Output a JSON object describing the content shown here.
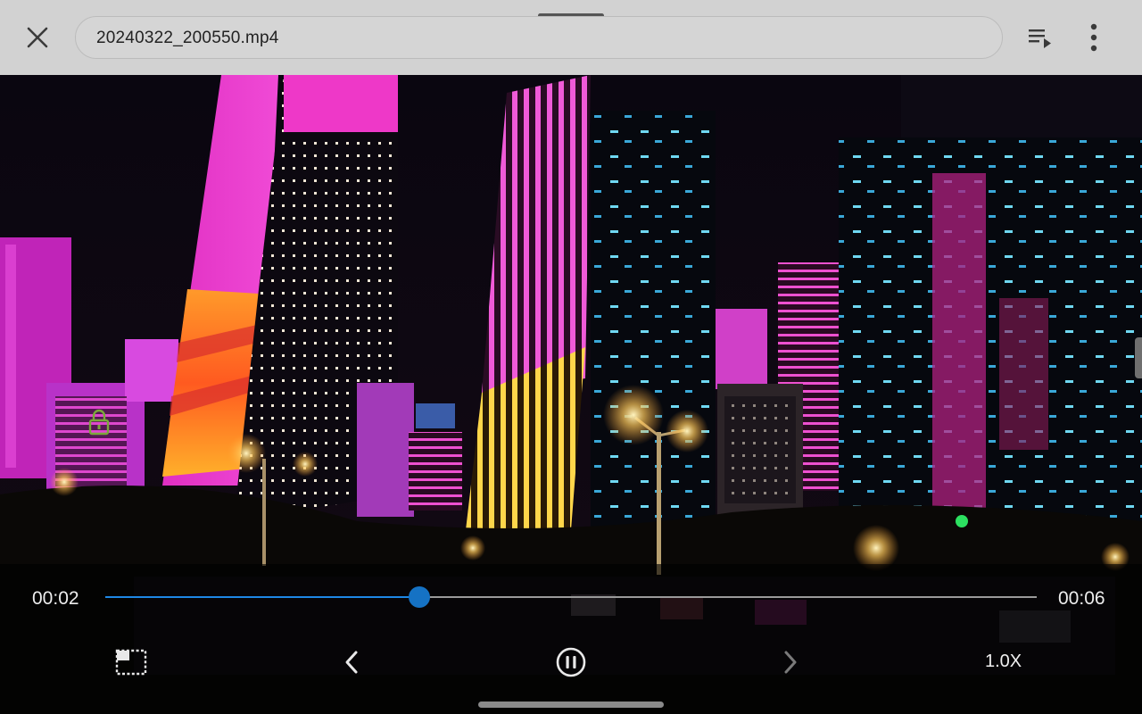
{
  "app": {
    "file_name": "20240322_200550.mp4"
  },
  "icons": {
    "close": "close-icon",
    "playlist": "playlist-play-icon",
    "more": "more-vert-icon",
    "lock": "lock-icon",
    "aspect": "aspect-ratio-icon",
    "previous": "chevron-left-icon",
    "pause": "pause-circle-icon",
    "next": "chevron-right-icon"
  },
  "player": {
    "current_time": "00:02",
    "total_time": "00:06",
    "progress": 0.337,
    "speed_label": "1.0X",
    "state": "playing"
  },
  "colors": {
    "accent": "#1572c4",
    "topbar": "#d2d2d2"
  }
}
